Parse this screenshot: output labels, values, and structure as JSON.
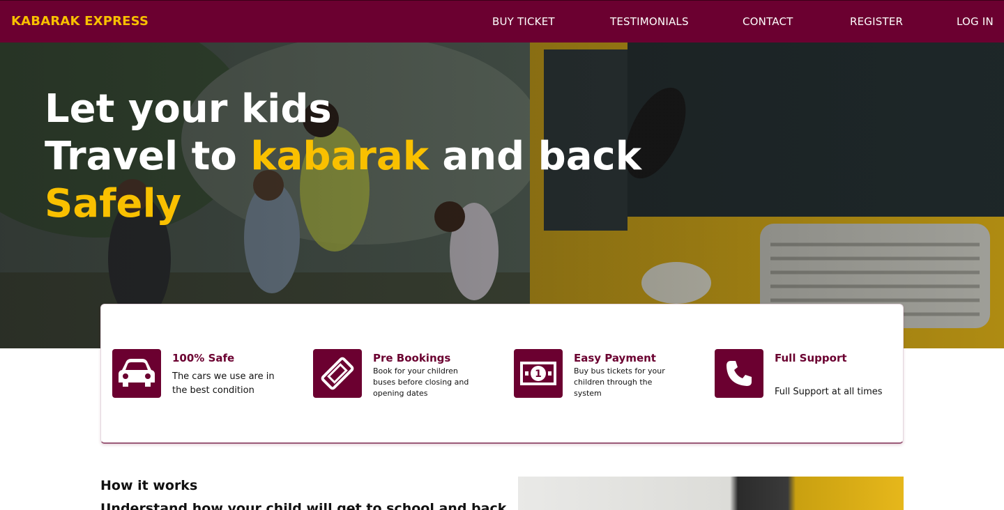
{
  "nav": {
    "brand": "KABARAK EXPRESS",
    "links": [
      "BUY TICKET",
      "TESTIMONIALS",
      "CONTACT",
      "REGISTER",
      "LOG IN"
    ]
  },
  "hero": {
    "line1": "Let your kids",
    "line2_start": "Travel to ",
    "line2_highlight": "kabarak",
    "line2_end": " and back",
    "line3": "Safely"
  },
  "features": [
    {
      "icon": "car-icon",
      "title": "100% Safe",
      "text": "The cars we use are in the best condition"
    },
    {
      "icon": "ticket-icon",
      "title": "Pre Bookings",
      "text": "Book for your children buses before closing and opening dates"
    },
    {
      "icon": "money-icon",
      "title": "Easy Payment",
      "text": "Buy bus tickets for your children through the system"
    },
    {
      "icon": "phone-icon",
      "title": "Full Support",
      "text": "Full Support at all times"
    }
  ],
  "how": {
    "title": "How it works",
    "subtitle": "Understand how your child will get to school and back"
  },
  "colors": {
    "brand": "#6b0030",
    "accent": "#f9c000"
  }
}
